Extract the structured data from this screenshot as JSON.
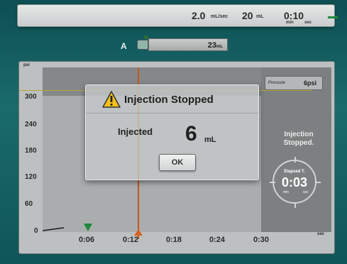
{
  "topbar": {
    "rate_value": "2.0",
    "rate_unit": "mL/sec",
    "volume_value": "20",
    "volume_unit": "mL",
    "time_value": "0:10",
    "time_min": "min",
    "time_sec": "sec"
  },
  "syringe": {
    "label": "A",
    "volume": "23",
    "unit": "mL"
  },
  "chart": {
    "y_unit": "psi",
    "x_unit": "sec",
    "y_ticks": [
      "300",
      "240",
      "180",
      "120",
      "60",
      "0"
    ],
    "x_ticks": [
      "0:06",
      "0:12",
      "0:18",
      "0:24",
      "0:30"
    ]
  },
  "pressure": {
    "label": "Pressure",
    "value": "6psi"
  },
  "status": {
    "line1": "Injection",
    "line2": "Stopped."
  },
  "elapsed": {
    "label": "Elapsed T.",
    "value": "0:03",
    "min": "min",
    "sec": "sec"
  },
  "dialog": {
    "title": "Injection Stopped",
    "injected_label": "Injected",
    "injected_value": "6",
    "injected_unit": "mL",
    "ok_label": "OK"
  },
  "colors": {
    "accent_green": "#1e8a3e",
    "orange_marker": "#c8541c",
    "warning_yellow": "#f4c01a"
  }
}
